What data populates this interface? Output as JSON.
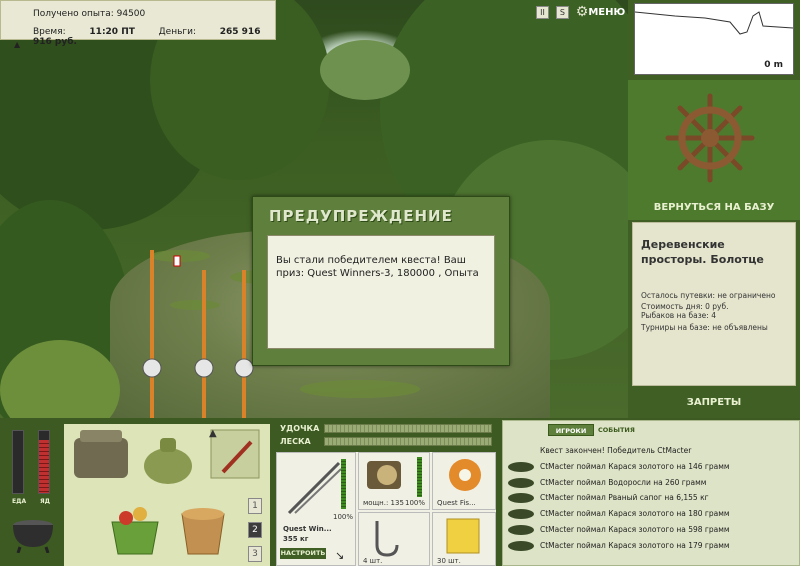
{
  "info": {
    "xp_label": "Получено опыта:",
    "xp_value": "94500",
    "time_label": "Время:",
    "time_value": "11:20 ПТ",
    "money_label": "Деньги:",
    "money_value": "265 916 916 руб."
  },
  "top_icons": {
    "pause_label": "II",
    "sound_label": "S",
    "menu_label": "МЕНЮ"
  },
  "depth": {
    "value": "0 m"
  },
  "right_panel": {
    "return_label": "ВЕРНУТЬСЯ НА БАЗУ",
    "location_title": "Деревенские просторы. Болотце",
    "lines": [
      "Осталось путевки: не ограничено",
      "Стоимость дня: 0 руб.",
      "Рыбаков на базе: 4",
      "Турниры на базе: не объявлены"
    ],
    "forbid_label": "ЗАПРЕТЫ"
  },
  "dialog": {
    "title": "ПРЕДУПРЕЖДЕНИЕ",
    "text": "Вы стали победителем квеста! Ваш приз: Quest Winners-3, 180000 , Опыта"
  },
  "meters": {
    "food_label": "ЕДА",
    "poison_label": "ЯД",
    "food_level": 0.0,
    "poison_level": 0.85
  },
  "pages": [
    "1",
    "2",
    "3"
  ],
  "active_page": "2",
  "tackle": {
    "rod_label": "УДОЧКА",
    "line_label": "ЛЕСКА",
    "rod_name": "Quest Win...",
    "rod_weight": "355 кг",
    "rod_percent": "100%",
    "reel_name": "мощн.: 135",
    "reel_percent": "100%",
    "line_name": "Quest Fis...",
    "hook_count": "4 шт.",
    "bait_count": "30 шт.",
    "tune_label": "НАСТРОИТЬ"
  },
  "log": {
    "tab_players": "ИГРОКИ",
    "tab_events": "СОБЫТИЯ",
    "header": "Квест закончен! Победитель CtMacter",
    "entries": [
      "CtMacter поймал Карася золотого на 146 грамм",
      "CtMacter поймал Водоросли на 260 грамм",
      "CtMacter поймал Рваный сапог на 6,155 кг",
      "CtMacter поймал Карася золотого на 180 грамм",
      "CtMacter поймал Карася золотого на 598 грамм",
      "CtMacter поймал Карася золотого на 179 грамм"
    ]
  }
}
